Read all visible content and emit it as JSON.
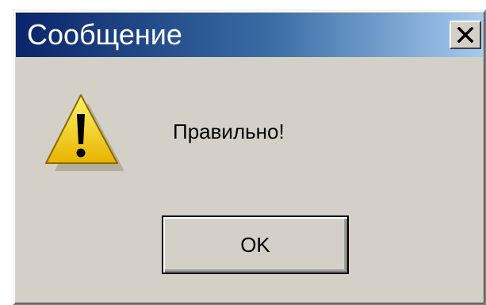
{
  "dialog": {
    "title": "Сообщение",
    "close_icon": "close-icon",
    "warning_icon": "warning-icon",
    "message": "Правильно!",
    "ok_label": "OK"
  },
  "colors": {
    "titlebar_start": "#0a246a",
    "titlebar_end": "#a6caf0",
    "dialog_face": "#d4d0c8",
    "warning_yellow": "#f7d020"
  }
}
